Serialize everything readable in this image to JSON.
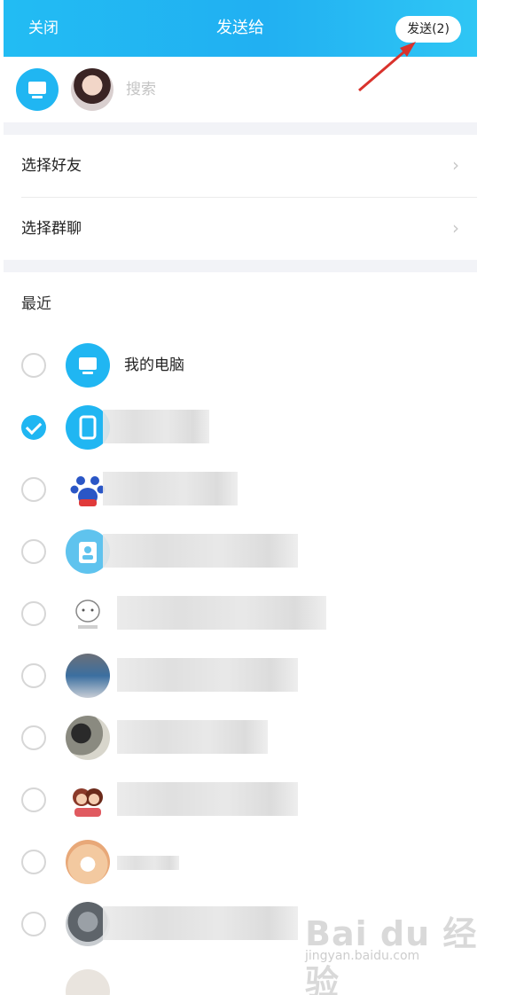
{
  "header": {
    "close_label": "关闭",
    "title": "发送给",
    "send_label": "发送(2)"
  },
  "search": {
    "placeholder": "搜索",
    "selected_avatars": [
      "pc-icon",
      "user-avatar"
    ]
  },
  "menu": [
    {
      "label": "选择好友",
      "chevron": "›"
    },
    {
      "label": "选择群聊",
      "chevron": "›"
    }
  ],
  "recent": {
    "title": "最近",
    "contacts": [
      {
        "name": "我的电脑",
        "checked": false,
        "avatar": "pc-icon"
      },
      {
        "name": "",
        "checked": true,
        "avatar": "phone-icon"
      },
      {
        "name": "",
        "checked": false,
        "avatar": "baidu-paw-avatar"
      },
      {
        "name": "",
        "checked": false,
        "avatar": "person-badge-avatar"
      },
      {
        "name": "",
        "checked": false,
        "avatar": "cartoon-avatar"
      },
      {
        "name": "",
        "checked": false,
        "avatar": "photo-avatar"
      },
      {
        "name": "",
        "checked": false,
        "avatar": "group-photo-avatar"
      },
      {
        "name": "",
        "checked": false,
        "avatar": "couple-avatar"
      },
      {
        "name": "",
        "checked": false,
        "avatar": "pet-avatar"
      },
      {
        "name": "",
        "checked": false,
        "avatar": "photo-avatar"
      }
    ]
  },
  "watermark": {
    "main": "Bai du 经验",
    "sub": "jingyan.baidu.com"
  },
  "colors": {
    "accent": "#20b6f2",
    "arrow": "#d9322c"
  }
}
